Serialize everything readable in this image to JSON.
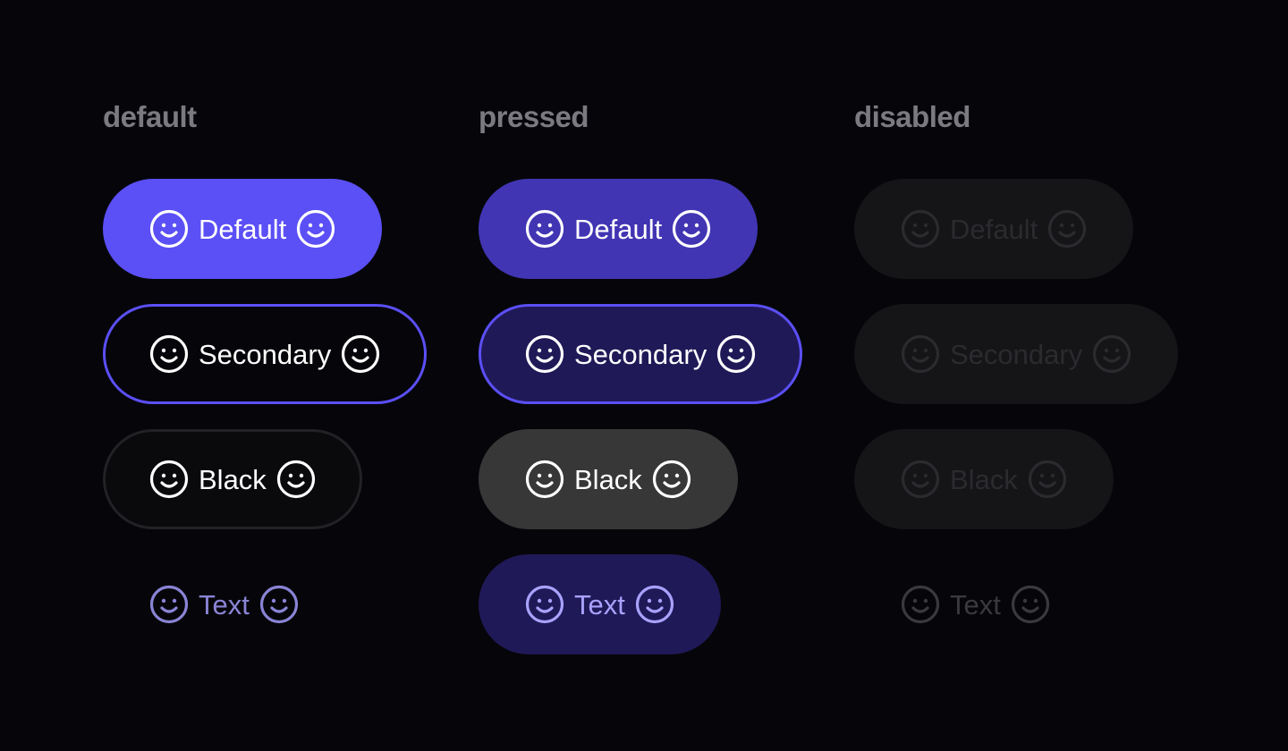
{
  "columns": {
    "default": "default",
    "pressed": "pressed",
    "disabled": "disabled"
  },
  "buttons": {
    "primary": "Default",
    "secondary": "Secondary",
    "black": "Black",
    "text": "Text"
  },
  "icons": {
    "leading": "smile-icon",
    "trailing": "smile-icon"
  },
  "colors": {
    "background": "#06060a",
    "accent": "#5b4ff6",
    "accent_pressed": "#4135b3",
    "secondary_pressed_bg": "#201957",
    "black_pressed_bg": "#373737",
    "disabled_bg": "#151517",
    "text_button_default": "#8a84d6",
    "text_button_pressed": "#a9a2ff",
    "column_title": "#7a7a80"
  }
}
